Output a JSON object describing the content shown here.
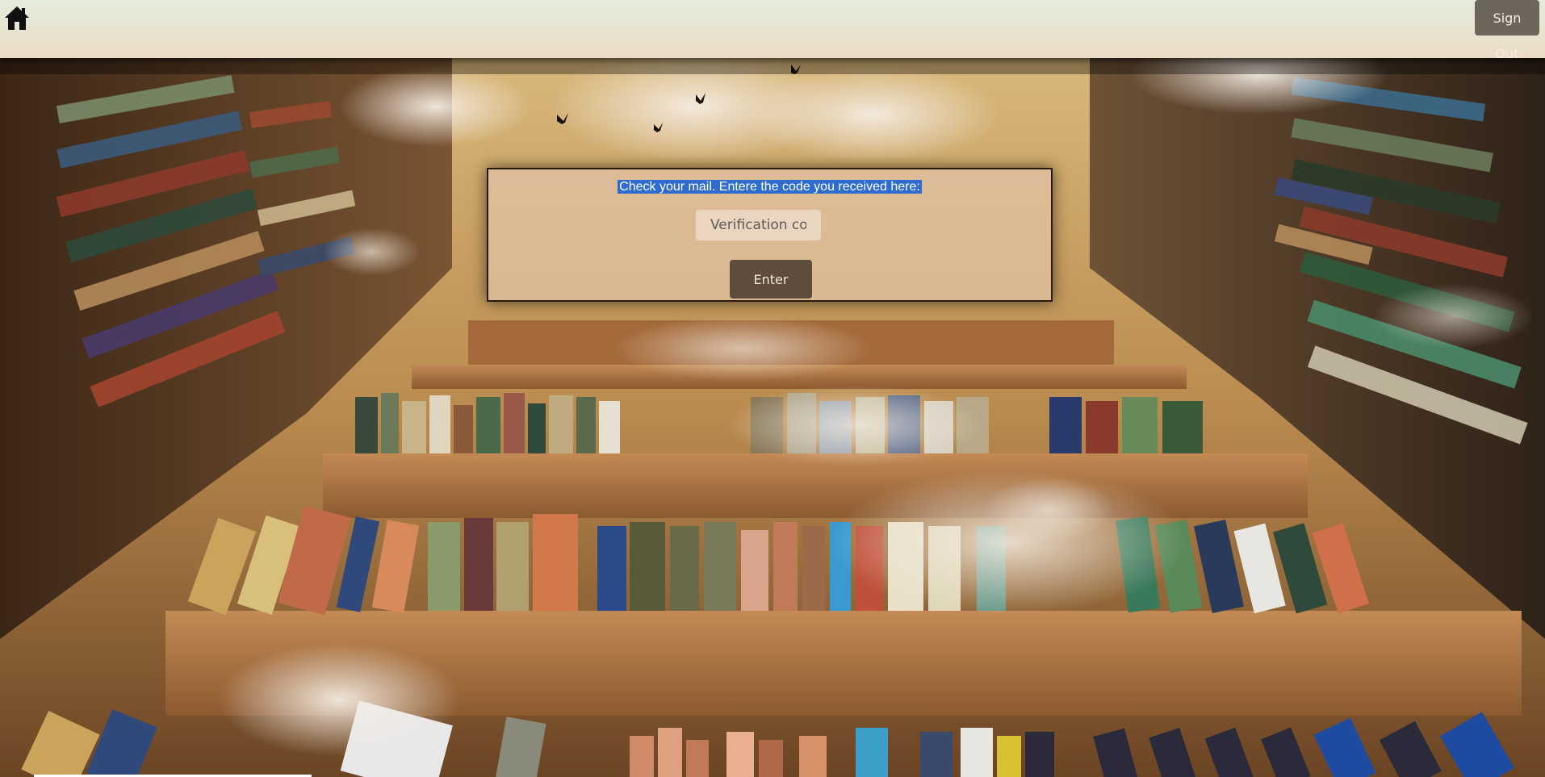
{
  "header": {
    "home_icon": "home-icon",
    "signout_label": "Sign Out"
  },
  "verify": {
    "prompt": "Check your mail. Entere the code you received here:",
    "code_placeholder": "Verification code",
    "code_value": "",
    "enter_label": "Enter"
  },
  "colors": {
    "header_top": "#e4ecdc",
    "header_bottom": "#ecdcc6",
    "button_bg": "#6d665b",
    "selection": "#2f6ccf"
  }
}
